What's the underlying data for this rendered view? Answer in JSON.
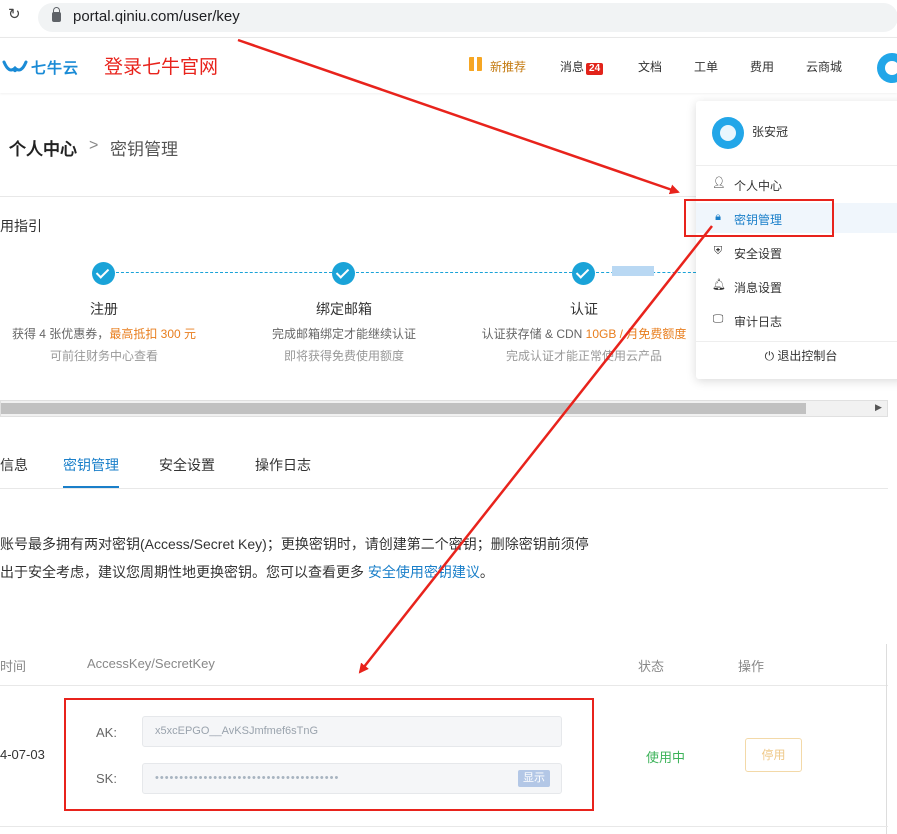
{
  "browser": {
    "url": "portal.qiniu.com/user/key"
  },
  "header": {
    "logo_text": "七牛云",
    "annotation": "登录七牛官网",
    "nav": {
      "new_push": "新推荐",
      "messages": "消息",
      "messages_count": "24",
      "docs": "文档",
      "tickets": "工单",
      "billing": "费用",
      "marketplace": "云商城"
    }
  },
  "breadcrumb": {
    "parent": "个人中心",
    "separator": ">",
    "current": "密钥管理"
  },
  "guide": {
    "title": "用指引",
    "steps": [
      {
        "title": "注册",
        "desc_prefix": "获得 4 张优惠券，",
        "desc_highlight": "最高抵扣 300 元",
        "desc2": "可前往财务中心查看"
      },
      {
        "title": "绑定邮箱",
        "desc": "完成邮箱绑定才能继续认证",
        "desc2": "即将获得免费使用额度"
      },
      {
        "title": "认证",
        "desc_prefix": "认证获存储 & CDN ",
        "desc_highlight": "10GB / 月免费额度",
        "desc2": "完成认证才能正常使用云产品"
      }
    ]
  },
  "tabs": [
    "信息",
    "密钥管理",
    "安全设置",
    "操作日志"
  ],
  "notice": {
    "line1": "账号最多拥有两对密钥(Access/Secret Key)；更换密钥时，请创建第二个密钥；删除密钥前须停",
    "line2_prefix": "出于安全考虑，建议您周期性地更换密钥。您可以查看更多 ",
    "line2_link": "安全使用密钥建议",
    "line2_suffix": "。"
  },
  "table": {
    "headers": {
      "time": "时间",
      "key": "AccessKey/SecretKey",
      "status": "状态",
      "action": "操作"
    },
    "row": {
      "date": "4-07-03",
      "ak_label": "AK:",
      "ak_value": "x5xcEPGO__AvKSJmfmef6sTnG",
      "sk_label": "SK:",
      "sk_value": "••••••••••••••••••••••••••••••••••••••",
      "show_label": "显示",
      "status": "使用中",
      "disable_label": "停用"
    }
  },
  "dropdown": {
    "user_name": "张安冠",
    "items": [
      {
        "label": "个人中心",
        "icon": "user-icon"
      },
      {
        "label": "密钥管理",
        "icon": "lock-icon"
      },
      {
        "label": "安全设置",
        "icon": "shield-icon"
      },
      {
        "label": "消息设置",
        "icon": "bell-icon"
      },
      {
        "label": "审计日志",
        "icon": "monitor-icon"
      }
    ],
    "logout": "退出控制台"
  },
  "colors": {
    "brand": "#1a8bd6",
    "accent": "#1a7fc9",
    "annotation_red": "#e8231c",
    "success": "#3db35a",
    "highlight_orange": "#e87e1e"
  }
}
